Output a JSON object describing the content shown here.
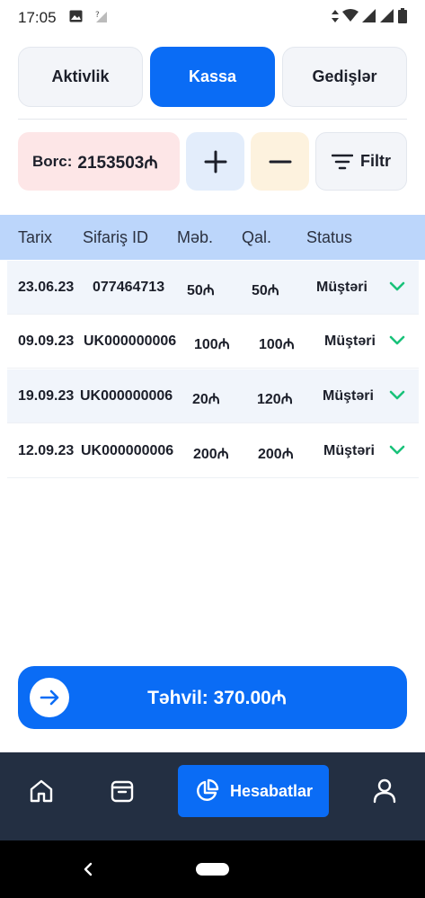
{
  "status_bar": {
    "time": "17:05"
  },
  "tabs": [
    {
      "label": "Aktivlik",
      "active": false
    },
    {
      "label": "Kassa",
      "active": true
    },
    {
      "label": "Gedişlər",
      "active": false
    }
  ],
  "balance": {
    "label": "Borc:",
    "value": "2153503₼"
  },
  "filter": {
    "label": "Filtr"
  },
  "table": {
    "headers": [
      "Tarix",
      "Sifariş ID",
      "Məb.",
      "Qal.",
      "Status"
    ],
    "rows": [
      {
        "date": "23.06.23",
        "order_id": "077464713",
        "amount": "50₼",
        "remaining": "50₼",
        "status": "Müştəri"
      },
      {
        "date": "09.09.23",
        "order_id": "UK000000006",
        "amount": "100₼",
        "remaining": "100₼",
        "status": "Müştəri"
      },
      {
        "date": "19.09.23",
        "order_id": "UK000000006",
        "amount": "20₼",
        "remaining": "120₼",
        "status": "Müştəri"
      },
      {
        "date": "12.09.23",
        "order_id": "UK000000006",
        "amount": "200₼",
        "remaining": "200₼",
        "status": "Müştəri"
      }
    ]
  },
  "handover": {
    "label": "Təhvil: 370.00₼"
  },
  "bottom_nav": {
    "active_label": "Hesabatlar"
  },
  "colors": {
    "primary": "#0a6cf5",
    "nav_bg": "#232f42",
    "accent_green": "#19c27a"
  }
}
